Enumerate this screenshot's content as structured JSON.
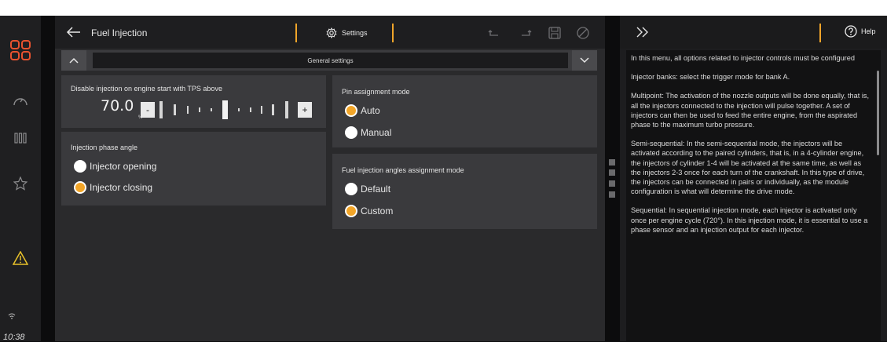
{
  "status": {
    "time": "10:38"
  },
  "rail": {
    "icons": [
      "dashboard-grid-icon",
      "gauge-icon",
      "bars-icon",
      "star-icon",
      "warning-icon",
      "wifi-icon"
    ]
  },
  "header": {
    "title": "Fuel Injection",
    "settings_label": "Settings"
  },
  "general_bar": {
    "label": "General settings"
  },
  "tps": {
    "title": "Disable injection on engine start with TPS above",
    "value": "70.0",
    "unit": "%",
    "minus": "-",
    "plus": "+"
  },
  "phase": {
    "title": "Injection phase angle",
    "options": [
      {
        "label": "Injector opening",
        "selected": false
      },
      {
        "label": "Injector closing",
        "selected": true
      }
    ]
  },
  "pin": {
    "title": "Pin assignment mode",
    "options": [
      {
        "label": "Auto",
        "selected": true
      },
      {
        "label": "Manual",
        "selected": false
      }
    ]
  },
  "angles": {
    "title": "Fuel injection angles assignment mode",
    "options": [
      {
        "label": "Default",
        "selected": false
      },
      {
        "label": "Custom",
        "selected": true
      }
    ]
  },
  "help": {
    "button_label": "Help",
    "paragraphs": [
      "In this menu, all options related to injector controls must be configured",
      "Injector banks: select the trigger mode for bank A.",
      "Multipoint: The activation of the nozzle outputs will be done equally, that is, all the injectors connected to the injection will pulse together. A set of injectors can then be used to feed the entire engine, from the aspirated phase to the maximum turbo pressure.",
      "Semi-sequential: In the semi-sequential mode, the injectors will be activated according to the paired cylinders, that is, in a 4-cylinder engine, the injectors of cylinder 1-4 will be activated at the same time, as well as the injectors 2-3 once for each turn of the crankshaft. In this type of drive, the injectors can be connected in pairs or individually, as the module configuration is what will determine the drive mode.",
      "Sequential: In sequential injection mode, each injector is activated only once per engine cycle (720°). In this injection mode, it is essential to use a phase sensor and an injection output for each injector."
    ]
  },
  "colors": {
    "accent": "#f2a528",
    "panel": "#3a3a3d",
    "background": "#2a2a2c"
  }
}
